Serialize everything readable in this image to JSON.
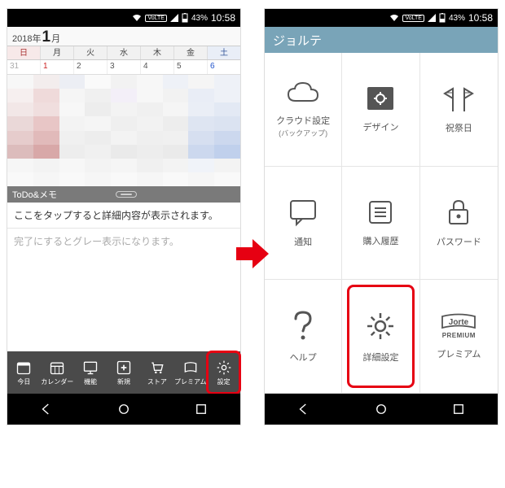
{
  "status": {
    "volte": "VoLTE",
    "battery_pct": "43%",
    "time": "10:58"
  },
  "left": {
    "year": "2018",
    "year_suffix": "年",
    "month": "1",
    "month_suffix": "月",
    "weekdays": [
      "日",
      "月",
      "火",
      "水",
      "木",
      "金",
      "土"
    ],
    "dates": [
      "31",
      "1",
      "2",
      "3",
      "4",
      "5",
      "6"
    ],
    "todo_header": "ToDo&メモ",
    "todo_hint": "ここをタップすると詳細内容が表示されます。",
    "todo_done": "完了にするとグレー表示になります。",
    "toolbar": {
      "today": "今日",
      "calendar": "カレンダー",
      "features": "機能",
      "new": "新規",
      "store": "ストア",
      "premium": "プレミアム",
      "settings": "設定"
    }
  },
  "right": {
    "title": "ジョルテ",
    "cells": {
      "cloud": "クラウド設定",
      "cloud_sub": "(バックアップ)",
      "design": "デザイン",
      "holidays": "祝祭日",
      "notify": "通知",
      "history": "購入履歴",
      "password": "パスワード",
      "help": "ヘルプ",
      "advanced": "詳細設定",
      "premium": "プレミアム",
      "premium_brand_top": "Jorte",
      "premium_brand_bottom": "PREMIUM"
    }
  }
}
